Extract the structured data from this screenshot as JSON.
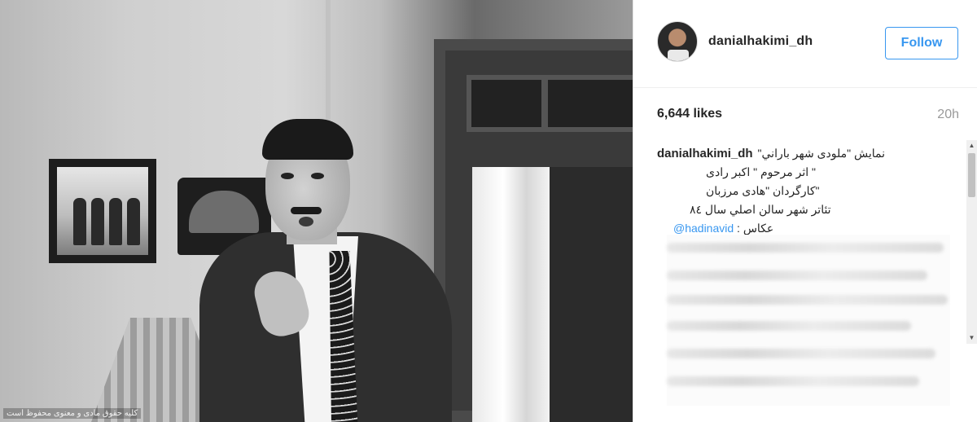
{
  "post": {
    "photo_watermark": "کلیه حقوق مادی و معنوی محفوظ است"
  },
  "header": {
    "username": "danialhakimi_dh",
    "follow_label": "Follow"
  },
  "stats": {
    "likes": "6,644 likes",
    "time_ago": "20h"
  },
  "caption": {
    "username": "danialhakimi_dh",
    "lines": [
      "نمایش \"ملودی شهر باراني\"",
      "\" اثر مرحوم \" اکبر رادی",
      "\"کارگردان \"هادی مرزبان",
      "تئاتر شهر سالن اصلي سال ۸٤",
      "عکاس :"
    ],
    "mention": "@hadinavid"
  },
  "colors": {
    "accent": "#3897f0",
    "text": "#262626",
    "muted": "#999999"
  },
  "icons": {
    "avatar": "profile-avatar",
    "scroll_up": "up-arrow-icon",
    "scroll_down": "down-arrow-icon"
  }
}
